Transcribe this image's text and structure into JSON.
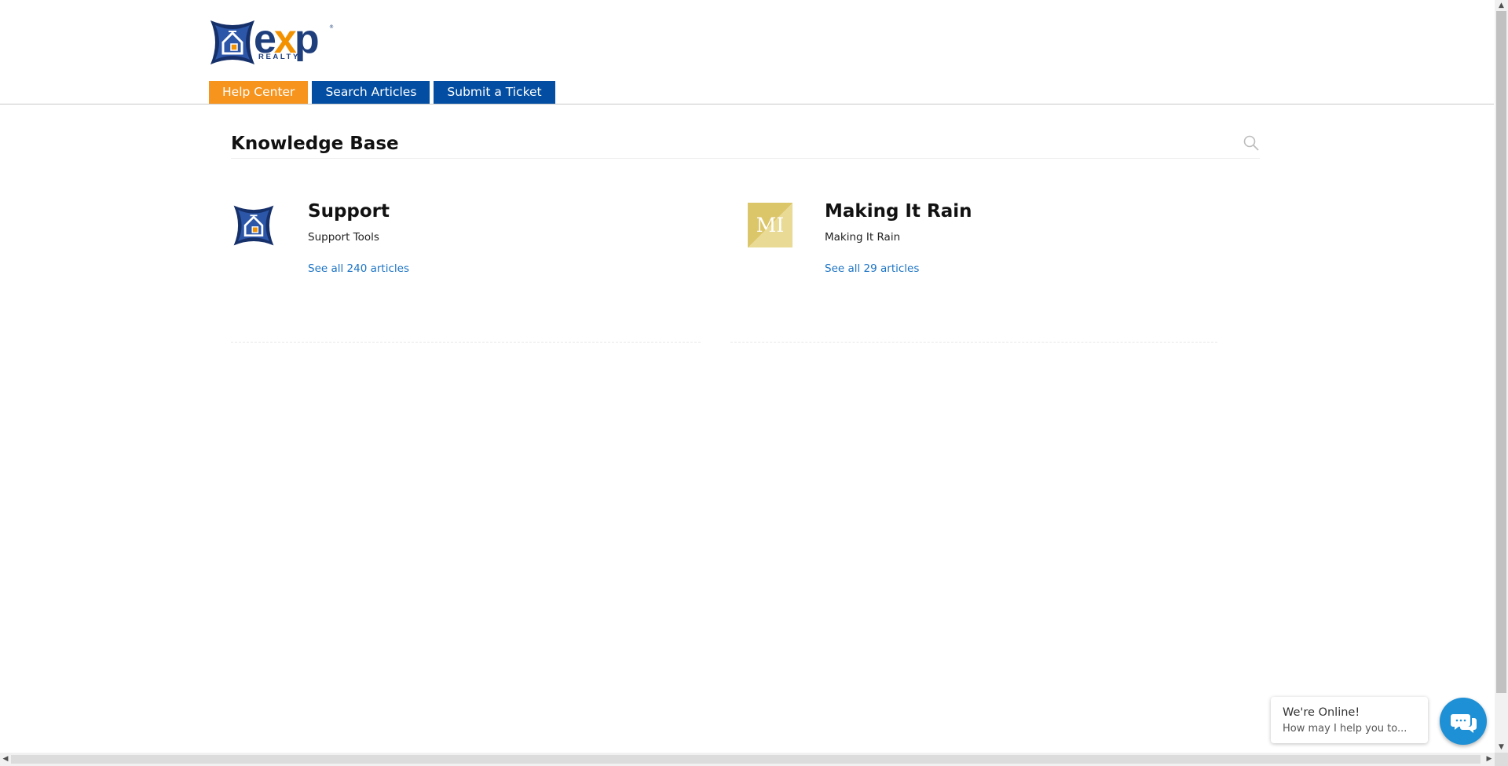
{
  "brand": {
    "logo_text_e": "e",
    "logo_text_x": "x",
    "logo_text_p": "p",
    "logo_sub": "REALTY",
    "logo_mark": "®",
    "colors": {
      "navy": "#1f3f7c",
      "orange": "#f39200",
      "tab_blue": "#034ea2",
      "tab_active": "#f7941d"
    }
  },
  "nav": {
    "tabs": [
      {
        "label": "Help Center",
        "active": true
      },
      {
        "label": "Search Articles",
        "active": false
      },
      {
        "label": "Submit a Ticket",
        "active": false
      }
    ]
  },
  "main": {
    "title": "Knowledge Base",
    "search_icon": "search-icon",
    "categories": [
      {
        "title": "Support",
        "description": "Support Tools",
        "link": "See all 240 articles",
        "icon": "exp-logo-icon"
      },
      {
        "title": "Making It Rain",
        "description": "Making It Rain",
        "link": "See all 29 articles",
        "icon_initials": "MI"
      }
    ]
  },
  "chat": {
    "line1": "We're Online!",
    "line2": "How may I help you to...",
    "icon": "chat-icon"
  }
}
